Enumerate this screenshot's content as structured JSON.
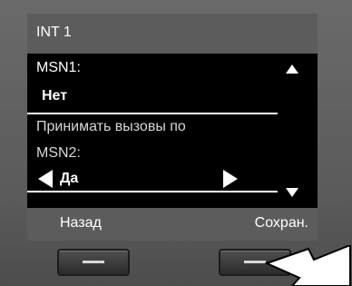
{
  "header": {
    "title": "INT 1"
  },
  "fields": [
    {
      "label": "MSN1:",
      "value": "Нет"
    },
    {
      "label": "Принимать вызовы по",
      "label2": "MSN2:",
      "value": "Да"
    }
  ],
  "softkeys": {
    "left": "Назад",
    "right": "Сохран."
  },
  "icons": {
    "scroll_up": "triangle-up-icon",
    "scroll_down": "triangle-down-icon",
    "option_prev": "triangle-left-icon",
    "option_next": "triangle-right-icon",
    "pointer": "arrow-pointer-icon"
  },
  "colors": {
    "screen_bg": "#000000",
    "header_bg": "#5c5c5c",
    "text": "#ffffff",
    "device_bg": "#5f5f5f"
  }
}
